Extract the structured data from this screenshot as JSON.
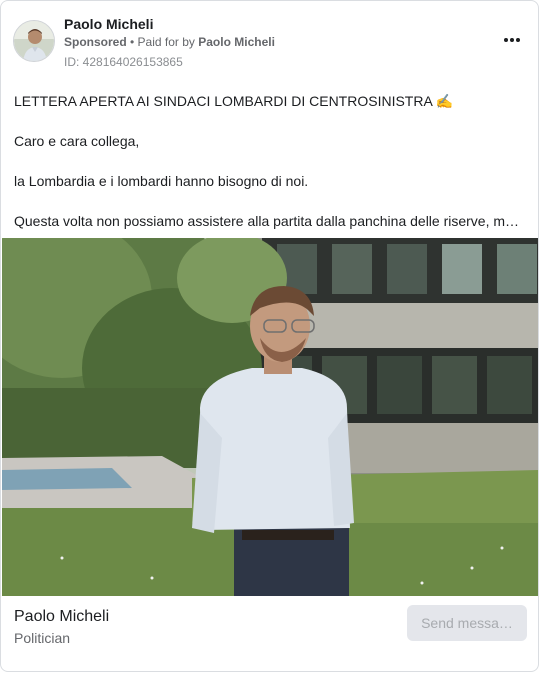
{
  "advertiser": {
    "name": "Paolo Micheli",
    "sponsored_label": "Sponsored",
    "separator": " • ",
    "paid_for_prefix": "Paid for by ",
    "payer": "Paolo Micheli",
    "ad_id": "ID: 428164026153865"
  },
  "body": {
    "lines": [
      "LETTERA APERTA AI SINDACI LOMBARDI DI CENTROSINISTRA ✍️",
      "Caro e cara collega,",
      "la Lombardia e i lombardi hanno bisogno di noi.",
      "Questa volta non possiamo assistere alla partita dalla panchina delle riserve, ma…"
    ]
  },
  "footer": {
    "page_name": "Paolo Micheli",
    "category": "Politician",
    "cta_label": "Send messa…"
  },
  "colors": {
    "card_border": "#dadde1",
    "secondary_text": "#65676b",
    "button_bg": "#e4e6eb",
    "button_text": "#a8abaf"
  },
  "icons": {
    "more": "more-options-icon"
  }
}
